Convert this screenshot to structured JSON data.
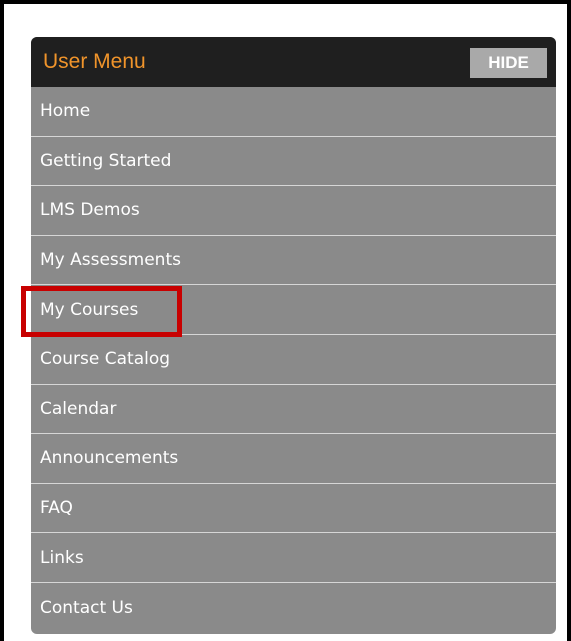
{
  "user_menu": {
    "title": "User Menu",
    "hide_label": "HIDE",
    "items": [
      {
        "label": "Home"
      },
      {
        "label": "Getting Started"
      },
      {
        "label": "LMS Demos"
      },
      {
        "label": "My Assessments"
      },
      {
        "label": "My Courses",
        "highlighted": true
      },
      {
        "label": "Course Catalog"
      },
      {
        "label": "Calendar"
      },
      {
        "label": "Announcements"
      },
      {
        "label": "FAQ"
      },
      {
        "label": "Links"
      },
      {
        "label": "Contact Us"
      }
    ]
  },
  "colors": {
    "header_bg": "#1f1f1f",
    "title": "#f0942b",
    "menu_bg": "#8a8a8a",
    "hide_button_bg": "#a9a9a9",
    "highlight_box": "#c80000"
  }
}
